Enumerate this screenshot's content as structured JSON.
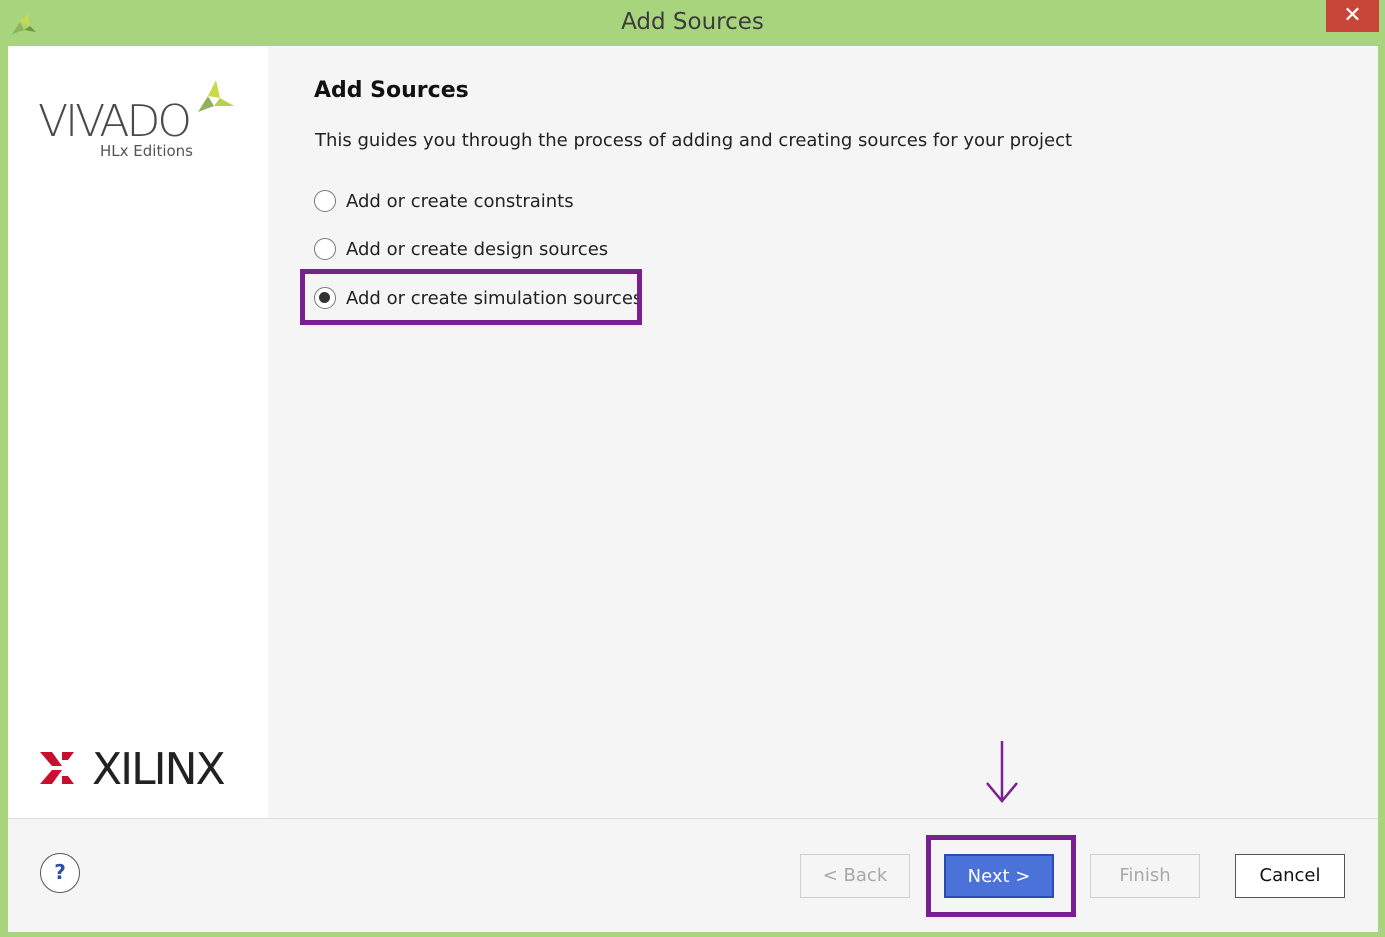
{
  "window": {
    "title": "Add Sources",
    "close_glyph": "✕",
    "app_icon": "vivado-leaf-icon"
  },
  "sidebar": {
    "vivado_logo_text": "VIVADO",
    "vivado_edition": "HLx Editions",
    "xilinx_logo_text": "XILINX"
  },
  "main": {
    "heading": "Add Sources",
    "description": "This guides you through the process of adding and creating sources for your project",
    "options": [
      {
        "label": "Add or create constraints",
        "checked": false
      },
      {
        "label": "Add or create design sources",
        "checked": false
      },
      {
        "label": "Add or create simulation sources",
        "checked": true
      }
    ]
  },
  "footer": {
    "help_label": "?",
    "back_label": "< Back",
    "next_label": "Next >",
    "finish_label": "Finish",
    "cancel_label": "Cancel"
  },
  "colors": {
    "titlebar": "#a9d47e",
    "highlight": "#7a1f8f",
    "primary_button": "#4a72d8",
    "close_button": "#c8453a"
  }
}
